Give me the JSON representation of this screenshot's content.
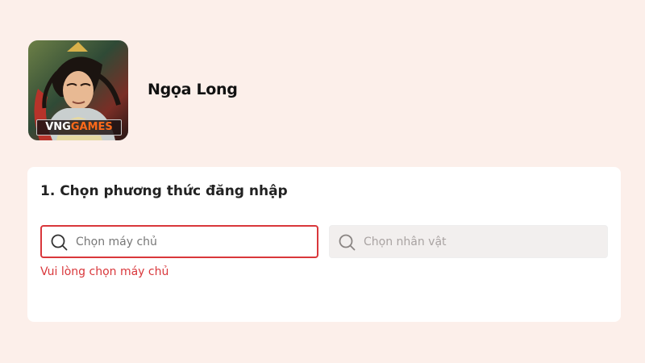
{
  "game": {
    "title": "Ngọa Long",
    "icon_name": "game-avatar-icon",
    "brand_part1": "VNG",
    "brand_part2": "GAMES"
  },
  "login": {
    "step_title": "1. Chọn phương thức đăng nhập",
    "server_placeholder": "Chọn máy chủ",
    "character_placeholder": "Chọn nhân vật",
    "server_error": "Vui lòng chọn máy chủ",
    "search_icon_name": "search-icon"
  },
  "colors": {
    "page_background": "#fcefea",
    "card_background": "#ffffff",
    "error": "#d9373b",
    "disabled_field": "#f2efee"
  }
}
